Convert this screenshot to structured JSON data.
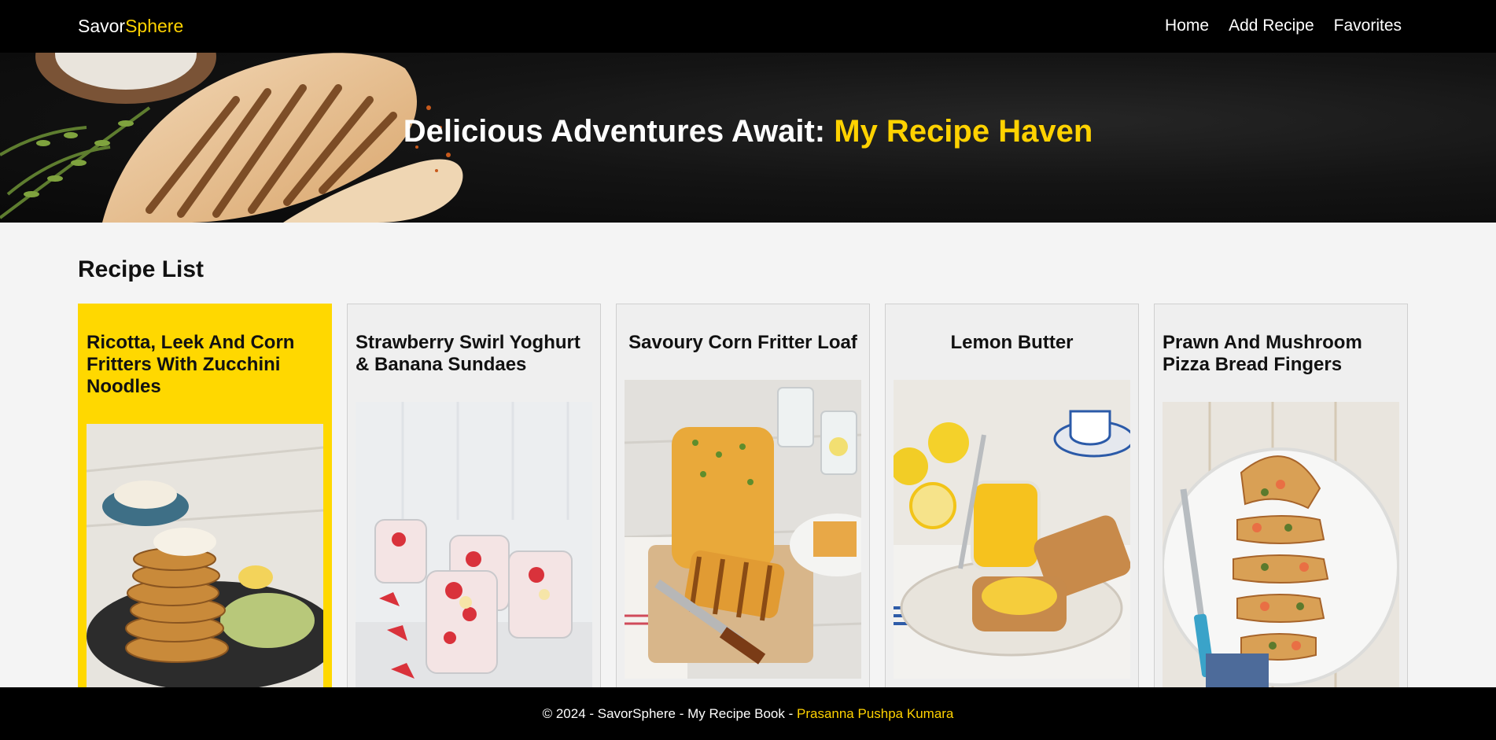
{
  "navbar": {
    "brand_part1": "Savor",
    "brand_part2": "Sphere",
    "links": [
      "Home",
      "Add Recipe",
      "Favorites"
    ]
  },
  "hero": {
    "title_part1": "Delicious Adventures Await: ",
    "title_part2": "My Recipe Haven"
  },
  "main": {
    "section_title": "Recipe List",
    "recipes": [
      {
        "title": "Ricotta, Leek And Corn Fritters With Zucchini Noodles",
        "highlighted": true
      },
      {
        "title": "Strawberry Swirl Yoghurt & Banana Sundaes",
        "highlighted": false
      },
      {
        "title": "Savoury Corn Fritter Loaf",
        "highlighted": false
      },
      {
        "title": "Lemon Butter",
        "highlighted": false
      },
      {
        "title": "Prawn And Mushroom Pizza Bread Fingers",
        "highlighted": false
      }
    ]
  },
  "footer": {
    "text": "© 2024 - SavorSphere - My Recipe Book - ",
    "author": "Prasanna Pushpa Kumara"
  },
  "colors": {
    "accent": "#ffd200",
    "nav_bg": "#000000",
    "page_bg": "#f4f4f4",
    "card_bg": "#efefef"
  }
}
